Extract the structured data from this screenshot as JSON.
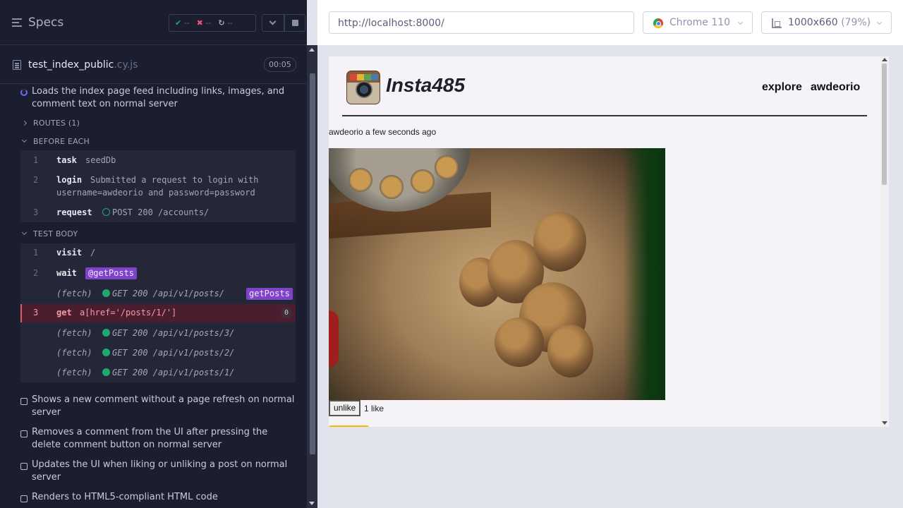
{
  "reporter": {
    "header": {
      "title": "Specs",
      "stats": {
        "passed": "--",
        "failed": "--",
        "pending": "--"
      }
    },
    "spec_file": {
      "name": "test_index_public",
      "ext": ".cy.js",
      "duration": "00:05"
    },
    "running_test": "Loads the index page feed including links, images, and comment text on normal server",
    "routes_label": "ROUTES (1)",
    "before_each_label": "BEFORE EACH",
    "before_each": [
      {
        "num": "1",
        "name": "task",
        "message": "seedDb"
      },
      {
        "num": "2",
        "name": "login",
        "message": "Submitted a request to login with",
        "message2": "username=awdeorio and password=password"
      },
      {
        "num": "3",
        "name": "request",
        "message": "POST 200 /accounts/"
      }
    ],
    "test_body_label": "TEST BODY",
    "test_body": {
      "visit": {
        "num": "1",
        "name": "visit",
        "message": "/"
      },
      "wait": {
        "num": "2",
        "name": "wait",
        "alias": "@getPosts"
      },
      "fetch_posts": {
        "name": "(fetch)",
        "message": "GET 200 /api/v1/posts/",
        "alias": "getPosts"
      },
      "get": {
        "num": "3",
        "name": "get",
        "message": "a[href='/posts/1/']",
        "count": "0"
      },
      "fetches": [
        {
          "name": "(fetch)",
          "message": "GET 200 /api/v1/posts/3/"
        },
        {
          "name": "(fetch)",
          "message": "GET 200 /api/v1/posts/2/"
        },
        {
          "name": "(fetch)",
          "message": "GET 200 /api/v1/posts/1/"
        }
      ]
    },
    "pending_tests": [
      "Shows a new comment without a page refresh on normal server",
      "Removes a comment from the UI after pressing the delete comment button on normal server",
      "Updates the UI when liking or unliking a post on normal server",
      "Renders to HTML5-compliant HTML code"
    ]
  },
  "aut": {
    "url": "http://localhost:8000/",
    "browser": "Chrome 110",
    "viewport": "1000x660",
    "viewport_pct": "(79%)"
  },
  "app": {
    "name": "Insta485",
    "nav": {
      "explore": "explore",
      "user": "awdeorio"
    },
    "post": {
      "owner": "awdeorio",
      "timestamp": "a few seconds ago",
      "unlike_label": "unlike",
      "likes": "1 like"
    }
  },
  "colors": {
    "reporter_bg": "#1b1e2e",
    "pass": "#1fa971",
    "fail": "#e45770",
    "alias": "#7f43c9",
    "running": "#6470f3"
  }
}
